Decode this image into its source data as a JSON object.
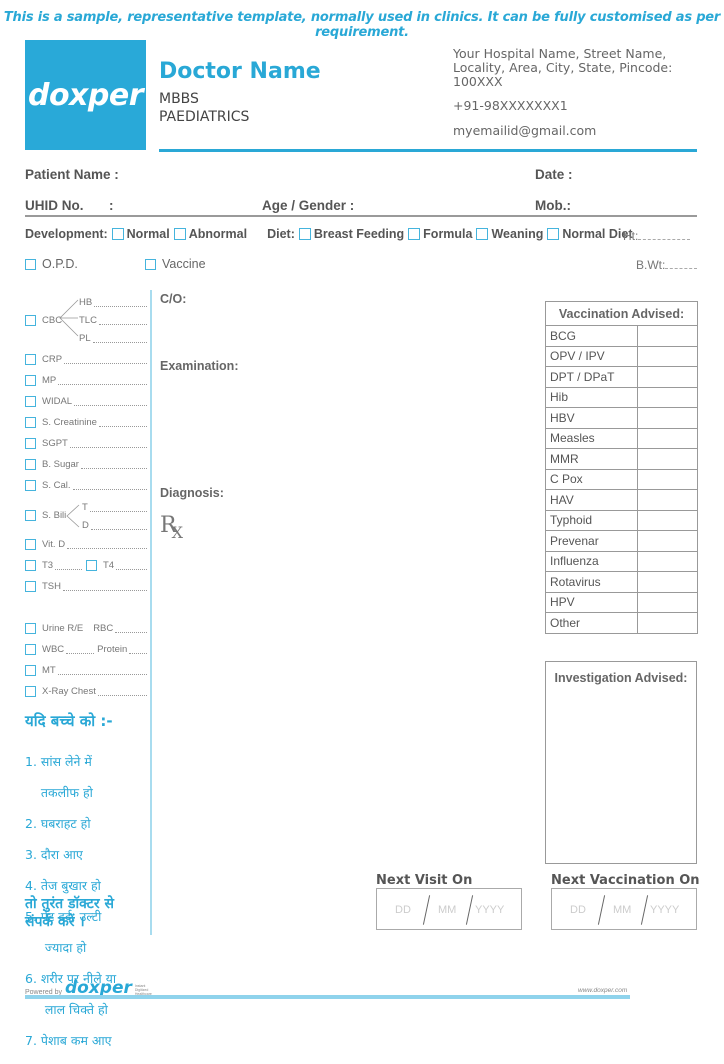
{
  "banner_note": "This is a sample, representative template, normally used in clinics. It can be fully customised as per requirement.",
  "logo_text": "doxper",
  "doctor": {
    "name": "Doctor Name",
    "qualification": "MBBS",
    "specialty": "PAEDIATRICS"
  },
  "hospital": {
    "address_line1": "Your Hospital Name, Street Name,",
    "address_line2": "Locality, Area, City, State, Pincode: 100XXX",
    "phone": "+91-98XXXXXXX1",
    "email": "myemailid@gmail.com"
  },
  "patient_fields": {
    "patient_name": "Patient Name :",
    "date": "Date :",
    "uhid": "UHID No.",
    "uhid_colon": ":",
    "age_gender": "Age / Gender :",
    "mobile": "Mob.:"
  },
  "development": {
    "label": "Development:",
    "options": [
      "Normal",
      "Abnormal"
    ]
  },
  "diet": {
    "label": "Diet:",
    "options": [
      "Breast Feeding",
      "Formula",
      "Weaning",
      "Normal Diet"
    ]
  },
  "height_label": "Ht:",
  "weight_label": "B.Wt:",
  "visit_type": [
    "O.P.D.",
    "Vaccine"
  ],
  "investigations": {
    "cbc": {
      "label": "CBC",
      "sub": [
        "HB",
        "TLC",
        "PL"
      ]
    },
    "items_a": [
      "CRP",
      "MP",
      "WIDAL",
      "S. Creatinine",
      "SGPT",
      "B. Sugar",
      "S. Cal."
    ],
    "sbili": {
      "label": "S. Bili",
      "sub": [
        "T",
        "D"
      ]
    },
    "vitd": "Vit. D",
    "t3": "T3",
    "t4": "T4",
    "tsh": "TSH",
    "urine": "Urine R/E",
    "rbc": "RBC",
    "wbc": "WBC",
    "protein": "Protein",
    "mt": "MT",
    "xray": "X-Ray Chest"
  },
  "sections": {
    "co": "C/O:",
    "examination": "Examination:",
    "diagnosis": "Diagnosis:",
    "rx": "R"
  },
  "hindi": {
    "heading": "यदि बच्चे को :-",
    "items": [
      "1. सांस लेने में",
      "    तकलीफ हो",
      "2. घबराहट हो",
      "3. दौरा आए",
      "4. तेज बुखार हो",
      "5. पेट दर्द, उल्टी",
      "     ज्यादा हो",
      "6. शरीर पर नीले या",
      "     लाल चिक्ते हो",
      "7. पेशाब कम आए"
    ],
    "footer_line1": "तो तुरंत डॉक्टर से",
    "footer_line2": "संपर्क करें ।"
  },
  "vaccination": {
    "title": "Vaccination Advised:",
    "rows": [
      "BCG",
      "OPV / IPV",
      "DPT / DPaT",
      "Hib",
      "HBV",
      "Measles",
      "MMR",
      "C Pox",
      "HAV",
      "Typhoid",
      "Prevenar",
      "Influenza",
      "Rotavirus",
      "HPV",
      "Other"
    ]
  },
  "investigation_advised": "Investigation Advised:",
  "next_visit": {
    "title": "Next Visit On",
    "dd": "DD",
    "mm": "MM",
    "yyyy": "YYYY"
  },
  "next_vaccination": {
    "title": "Next Vaccination On",
    "dd": "DD",
    "mm": "MM",
    "yyyy": "YYYY"
  },
  "footer": {
    "powered_by": "Powered by",
    "brand": "doxper",
    "tagline": "Instant Digitized Healthcare",
    "website": "www.doxper.com"
  },
  "colors": {
    "accent": "#29a8d6",
    "light_accent": "#a8dcef"
  }
}
